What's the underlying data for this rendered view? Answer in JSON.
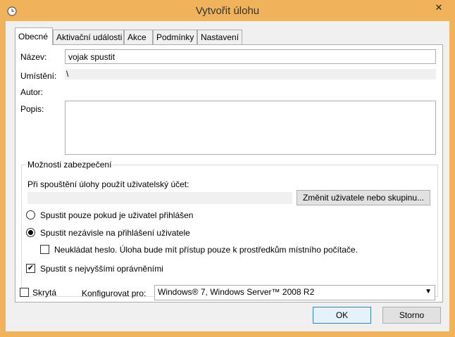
{
  "window": {
    "title": "Vytvořit úlohu",
    "close_glyph": "✕"
  },
  "tabs": [
    {
      "label": "Obecné"
    },
    {
      "label": "Aktivační události"
    },
    {
      "label": "Akce"
    },
    {
      "label": "Podmínky"
    },
    {
      "label": "Nastavení"
    }
  ],
  "general": {
    "name_label": "Název:",
    "name_value": "vojak spustit",
    "location_label": "Umístění:",
    "location_value": "\\",
    "author_label": "Autor:",
    "author_value": "",
    "description_label": "Popis:",
    "description_value": ""
  },
  "security": {
    "group_title": "Možnosti zabezpečení",
    "account_prompt": "Při spouštění úlohy použít uživatelský účet:",
    "account_value": "",
    "change_user_button": "Změnit uživatele nebo skupinu...",
    "run_only_logged_on": "Spustit pouze pokud je uživatel přihlášen",
    "run_whether_logged_on": "Spustit nezávisle na přihlášení uživatele",
    "selected_run_option": "run_whether_logged_on",
    "do_not_store_password": "Neukládat heslo.  Úloha bude mít přístup pouze k prostředkům místního počítače.",
    "do_not_store_password_checked": false,
    "highest_privileges": "Spustit s nejvyššími oprávněními",
    "highest_privileges_checked": true
  },
  "bottom": {
    "hidden_label": "Skrytá",
    "hidden_checked": false,
    "configure_label": "Konfigurovat pro:",
    "configure_value": "Windows® 7, Windows Server™ 2008 R2"
  },
  "buttons": {
    "ok": "OK",
    "cancel": "Storno"
  },
  "colors": {
    "title_bar": "#f0b35b",
    "dialog_bg": "#f0f0f0",
    "panel_bg": "#ffffff",
    "default_button_border": "#3c7fb1"
  },
  "icons": {
    "app": "clock-icon",
    "close": "close-icon",
    "dropdown": "chevron-down-icon"
  }
}
